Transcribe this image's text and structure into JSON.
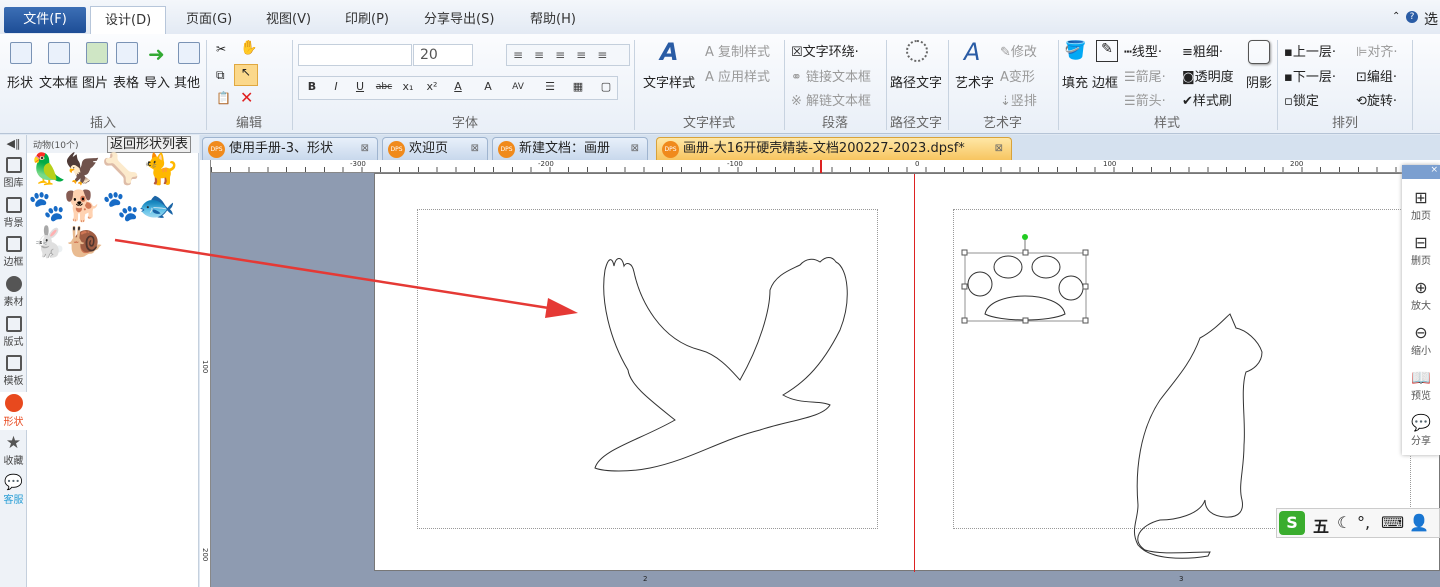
{
  "menu": {
    "items": [
      "文件(F)",
      "设计(D)",
      "页面(G)",
      "视图(V)",
      "印刷(P)",
      "分享导出(S)",
      "帮助(H)"
    ],
    "right_label": "选"
  },
  "ribbon": {
    "insert": {
      "buttons": [
        "形状",
        "文本框",
        "图片",
        "表格",
        "导入",
        "其他"
      ],
      "label": "插入"
    },
    "edit": {
      "label": "编辑"
    },
    "font": {
      "font_name": "",
      "font_size": "20",
      "label": "字体",
      "buttons": [
        "B",
        "I",
        "U",
        "abc",
        "x₁",
        "x²",
        "A",
        "A",
        "AV"
      ]
    },
    "text_style": {
      "main": "文字样式",
      "copy": "复制样式",
      "apply": "应用样式",
      "label": "文字样式"
    },
    "paragraph": {
      "wrap": "文字环绕",
      "link": "链接文本框",
      "unlink": "解链文本框",
      "label": "段落"
    },
    "path_text": {
      "main": "路径文字",
      "label": "路径文字"
    },
    "art_text": {
      "main": "艺术字",
      "modify": "修改",
      "transform": "变形",
      "vertical": "竖排",
      "label": "艺术字"
    },
    "style": {
      "fill": "填充",
      "border": "边框",
      "line_type": "线型",
      "weight": "粗细",
      "tail": "箭尾",
      "transparency": "透明度",
      "head": "箭头",
      "brush": "样式刷",
      "shadow": "阴影",
      "label": "样式"
    },
    "arrange": {
      "up": "上一层",
      "align": "对齐",
      "down": "下一层",
      "group": "编组",
      "lock": "锁定",
      "rotate": "旋转",
      "label": "排列"
    }
  },
  "left_tabs": [
    "图库",
    "背景",
    "边框",
    "素材",
    "版式",
    "模板",
    "形状",
    "收藏",
    "客服"
  ],
  "panel": {
    "title": "动物(10个)",
    "back_button": "返回形状列表",
    "shapes": [
      "parrot",
      "eagle",
      "bone",
      "cat",
      "paw",
      "dog",
      "paw-print",
      "fish",
      "rabbit",
      "snail"
    ]
  },
  "doc_tabs": [
    {
      "label": "使用手册-3、形状",
      "active": false
    },
    {
      "label": "欢迎页",
      "active": false
    },
    {
      "label": "新建文档：画册",
      "active": false
    },
    {
      "label": "画册-大16开硬壳精装-文档200227-2023.dpsf*",
      "active": true
    }
  ],
  "ruler": {
    "top": [
      "-300",
      "-200",
      "-100",
      "0",
      "100",
      "200"
    ],
    "left": [
      "100",
      "200"
    ]
  },
  "pages": [
    "2",
    "3"
  ],
  "side_tools": [
    "加页",
    "删页",
    "放大",
    "缩小",
    "预览",
    "分享"
  ],
  "ime": {
    "mode": "五"
  },
  "colors": {
    "accent": "#e8491e",
    "file_menu": "#2a5ca5",
    "active_tab": "#f7c560"
  }
}
